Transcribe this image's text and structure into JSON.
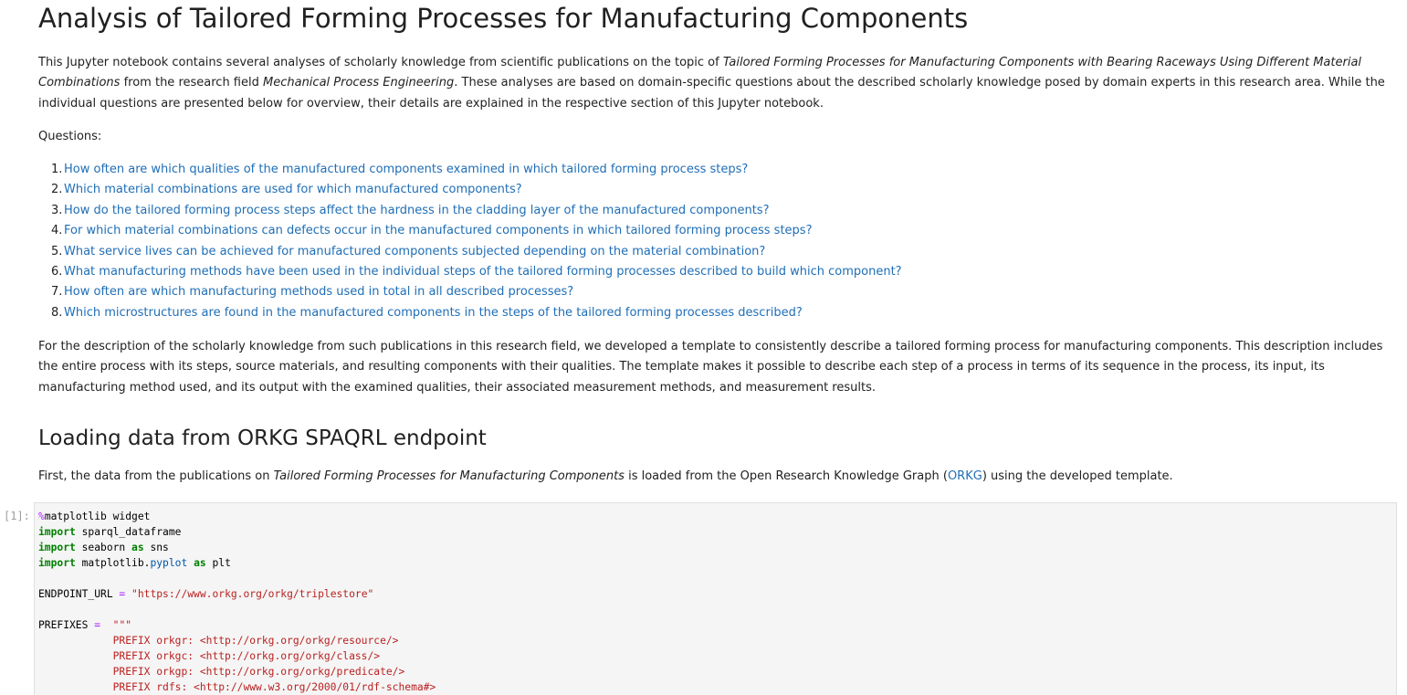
{
  "title": "Analysis of Tailored Forming Processes for Manufacturing Components",
  "intro": {
    "t1": "This Jupyter notebook contains several analyses of scholarly knowledge from scientific publications on the topic of ",
    "topic": "Tailored Forming Processes for Manufacturing Components with Bearing Raceways Using Different Material Combinations",
    "t2": " from the research field ",
    "field": "Mechanical Process Engineering",
    "t3": ". These analyses are based on domain-specific questions about the described scholarly knowledge posed by domain experts in this research area. While the individual questions are presented below for overview, their details are explained in the respective section of this Jupyter notebook."
  },
  "questions_label": "Questions:",
  "questions": [
    {
      "num": "1.",
      "text": "How often are which qualities of the manufactured components examined in which tailored forming process steps?"
    },
    {
      "num": "2.",
      "text": "Which material combinations are used for which manufactured components?"
    },
    {
      "num": "3.",
      "text": "How do the tailored forming process steps affect the hardness in the cladding layer of the manufactured components?"
    },
    {
      "num": "4.",
      "text": "For which material combinations can defects occur in the manufactured components in which tailored forming process steps?"
    },
    {
      "num": "5.",
      "text": "What service lives can be achieved for manufactured components subjected depending on the material combination?"
    },
    {
      "num": "6.",
      "text": "What manufacturing methods have been used in the individual steps of the tailored forming processes described to build which component?"
    },
    {
      "num": "7.",
      "text": "How often are which manufacturing methods used in total in all described processes?"
    },
    {
      "num": "8.",
      "text": "Which microstructures are found in the manufactured components in the steps of the tailored forming processes described?"
    }
  ],
  "description": "For the description of the scholarly knowledge from such publications in this research field, we developed a template to consistently describe a tailored forming process for manufacturing components. This description includes the entire process with its steps, source materials, and resulting components with their qualities. The template makes it possible to describe each step of a process in terms of its sequence in the process, its input, its manufacturing method used, and its output with the examined qualities, their associated measurement methods, and measurement results.",
  "section2": {
    "heading": "Loading data from ORKG SPAQRL endpoint",
    "t1": "First, the data from the publications on ",
    "topic": "Tailored Forming Processes for Manufacturing Components",
    "t2": " is loaded from the Open Research Knowledge Graph (",
    "link": "ORKG",
    "t3": ") using the developed template."
  },
  "cell": {
    "prompt": "[1]:",
    "lines": {
      "l1_magic": "%",
      "l1_rest": "matplotlib widget",
      "l2_kw": "import",
      "l2_rest": " sparql_dataframe",
      "l3_kw": "import",
      "l3_a": " seaborn ",
      "l3_as": "as",
      "l3_b": " sns",
      "l4_kw": "import",
      "l4_a": " matplotlib.",
      "l4_mod": "pyplot",
      "l4_as": "as",
      "l4_b": " plt",
      "l6_a": "ENDPOINT_URL ",
      "l6_op": "=",
      "l6_str": "\"https://www.orkg.org/orkg/triplestore\"",
      "l8_a": "PREFIXES ",
      "l8_op": "=",
      "l8_str": "\"\"\"",
      "l9": "PREFIX orkgr: <http://orkg.org/orkg/resource/>",
      "l10": "PREFIX orkgc: <http://orkg.org/orkg/class/>",
      "l11": "PREFIX orkgp: <http://orkg.org/orkg/predicate/>",
      "l12": "PREFIX rdfs: <http://www.w3.org/2000/01/rdf-schema#>"
    }
  },
  "colors": {
    "link": "#1f6eb6",
    "keyword": "#008000",
    "string": "#ba2121",
    "magic": "#aa22ff",
    "code_bg": "#f5f5f5"
  }
}
